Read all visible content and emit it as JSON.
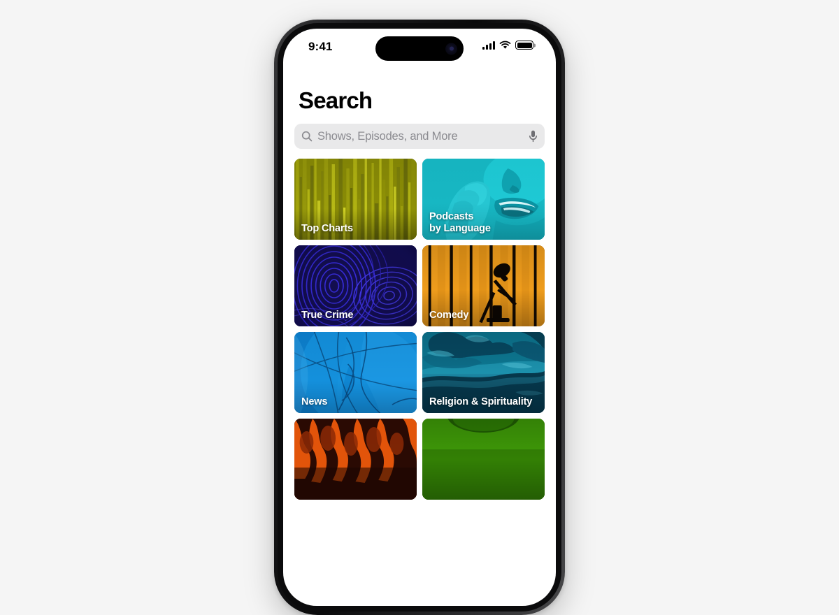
{
  "background_color": "#f5f5f5",
  "device": {
    "name": "iphone-frame",
    "frame_color": "#1c1c1e",
    "screen_background": "#ffffff",
    "buttons": [
      "mute-switch",
      "volume-up",
      "volume-down",
      "power"
    ]
  },
  "status_bar": {
    "time": "9:41",
    "cellular_icon": "cellular-signal-icon",
    "cellular_bars": 4,
    "wifi_icon": "wifi-icon",
    "battery_icon": "battery-icon",
    "battery_full": true,
    "dynamic_island": "dynamic-island",
    "camera_icon": "front-camera-icon"
  },
  "header": {
    "title": "Search"
  },
  "search": {
    "placeholder": "Shows, Episodes, and More",
    "value": "",
    "search_icon": "search-icon",
    "mic_icon": "microphone-icon",
    "field_color": "#e9e9ea",
    "placeholder_color": "#8b8b90"
  },
  "categories": [
    {
      "label": "Top Charts",
      "art": "equalizer-bars-olive",
      "accent": "#8a8c06",
      "visible": "full"
    },
    {
      "label": "Podcasts\nby Language",
      "art": "whispering-person-teal",
      "accent": "#13a9b6",
      "visible": "full"
    },
    {
      "label": "True Crime",
      "art": "fingerprint-blue",
      "accent": "#2a22c8",
      "visible": "full"
    },
    {
      "label": "Comedy",
      "art": "microphone-orange-curtain",
      "accent": "#ef9d1c",
      "visible": "full"
    },
    {
      "label": "News",
      "art": "globe-blue",
      "accent": "#0e86d4",
      "visible": "full"
    },
    {
      "label": "Religion & Spirituality",
      "art": "clouds-teal",
      "accent": "#0d7d9c",
      "visible": "full"
    },
    {
      "label": "",
      "art": "fire-orange",
      "accent": "#e2540a",
      "visible": "partial-cut-off"
    },
    {
      "label": "",
      "art": "green-abstract",
      "accent": "#3f9a08",
      "visible": "partial-cut-off"
    }
  ]
}
